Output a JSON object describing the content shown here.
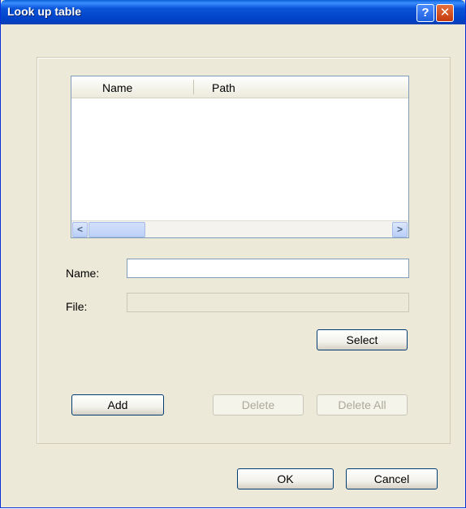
{
  "window": {
    "title": "Look up table"
  },
  "titlebar": {
    "help_label": "?",
    "close_label": "✕"
  },
  "list": {
    "columns": [
      "Name",
      "Path"
    ],
    "scroll_left_label": "<",
    "scroll_right_label": ">"
  },
  "form": {
    "name_label": "Name:",
    "name_value": "",
    "file_label": "File:",
    "file_value": ""
  },
  "buttons": {
    "select": "Select",
    "add": "Add",
    "delete": "Delete",
    "delete_all": "Delete All",
    "ok": "OK",
    "cancel": "Cancel"
  }
}
